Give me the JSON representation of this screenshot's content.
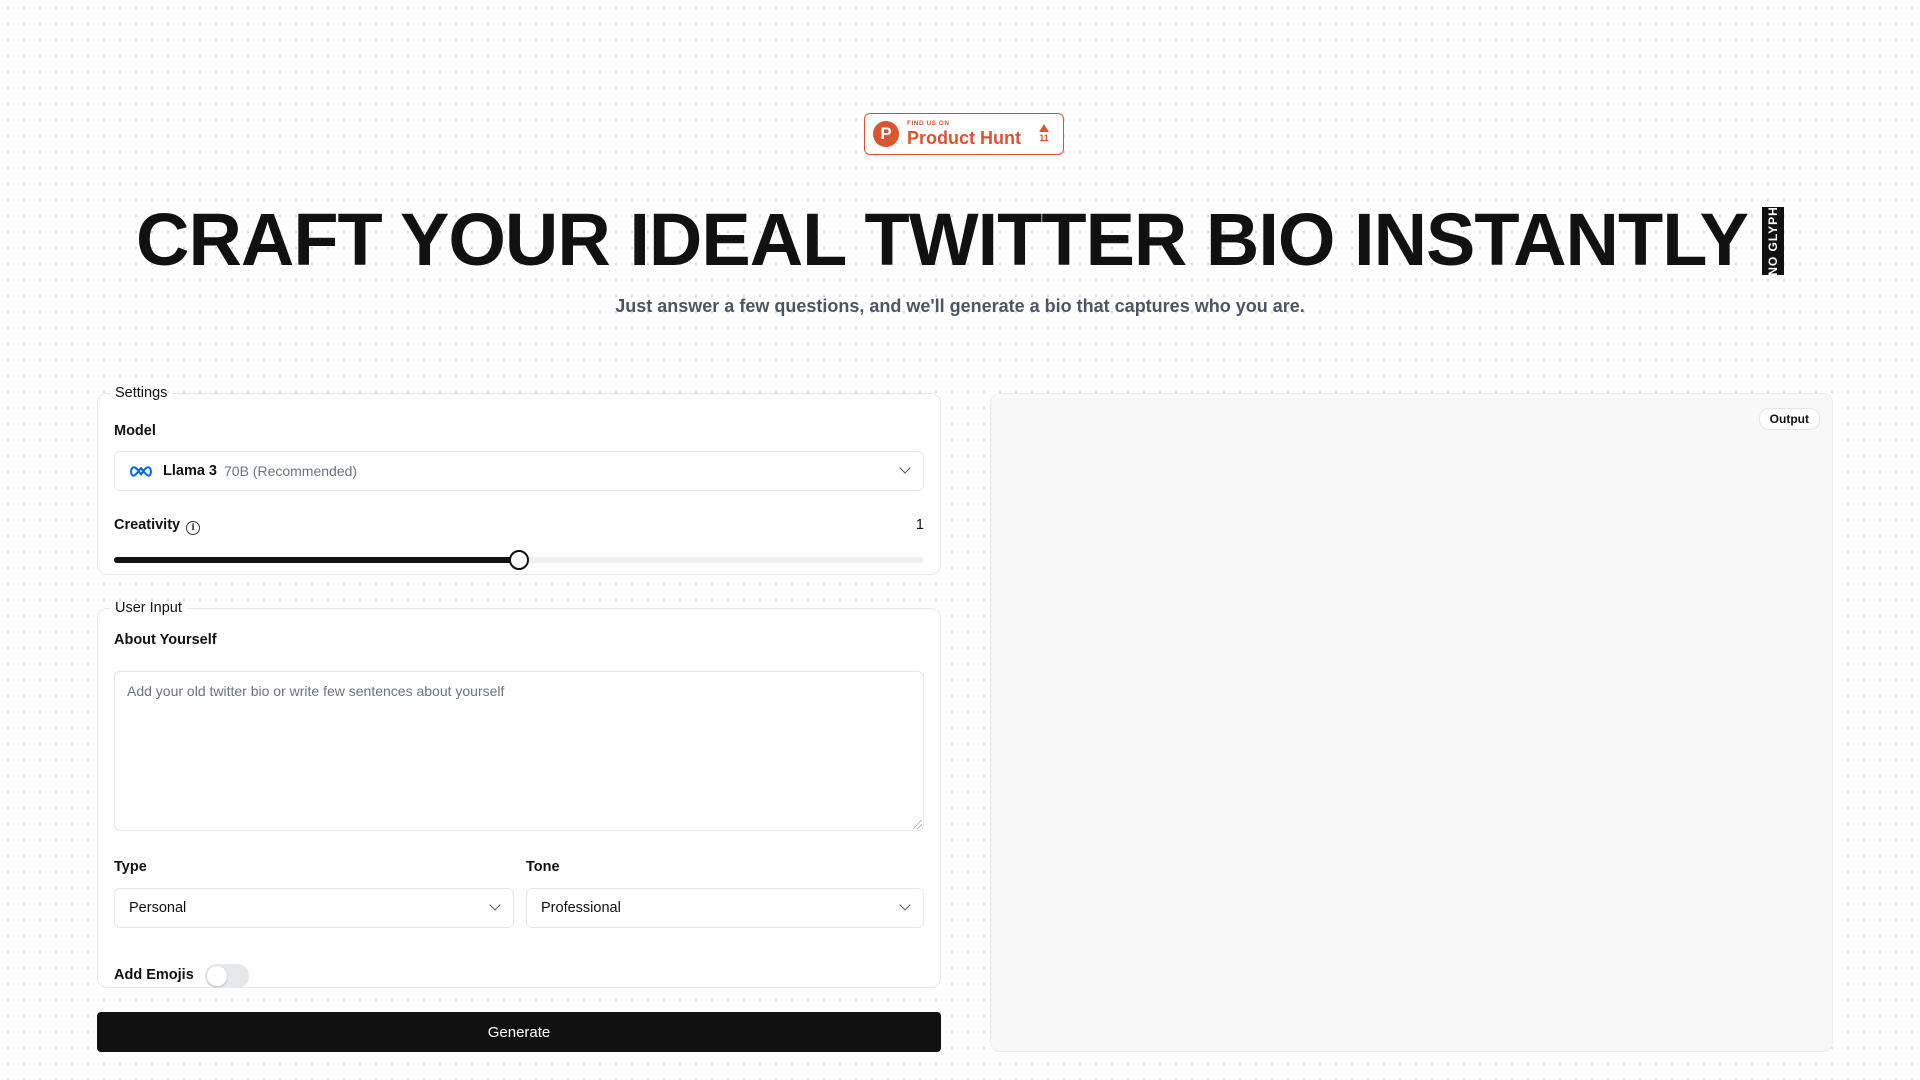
{
  "product_hunt": {
    "find_us_on": "FIND US ON",
    "name": "Product Hunt",
    "logo_letter": "P",
    "votes": "11",
    "color": "#da552f"
  },
  "hero": {
    "headline": "CRAFT YOUR IDEAL TWITTER BIO INSTANTLY",
    "glyph_fallback": "NO GLYPH",
    "subtitle": "Just answer a few questions, and we'll generate a bio that captures who you are."
  },
  "settings": {
    "legend": "Settings",
    "model_label": "Model",
    "model_name": "Llama 3",
    "model_desc": "70B (Recommended)",
    "model_icon": "meta-icon",
    "creativity_label": "Creativity",
    "creativity_value": "1",
    "creativity_fraction": 0.5
  },
  "user_input": {
    "legend": "User Input",
    "about_label": "About Yourself",
    "about_placeholder": "Add your old twitter bio or write few sentences about yourself",
    "type_label": "Type",
    "type_value": "Personal",
    "tone_label": "Tone",
    "tone_value": "Professional",
    "emojis_label": "Add Emojis",
    "emojis_enabled": false
  },
  "generate_label": "Generate",
  "output": {
    "chip_label": "Output"
  },
  "colors": {
    "primary": "#111111",
    "muted_text": "#6b7280",
    "border": "#e5e7eb",
    "output_bg": "#f8f8f8"
  }
}
